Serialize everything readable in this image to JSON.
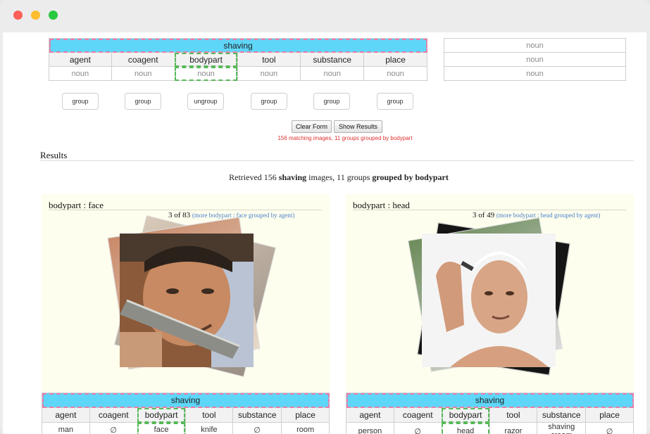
{
  "window": {
    "controls": [
      "close",
      "minimize",
      "zoom"
    ]
  },
  "query": {
    "verb": "shaving",
    "roles": [
      "agent",
      "coagent",
      "bodypart",
      "tool",
      "substance",
      "place"
    ],
    "values": [
      "noun",
      "noun",
      "noun",
      "noun",
      "noun",
      "noun"
    ],
    "selected_role": "bodypart",
    "side_values": [
      "noun",
      "noun",
      "noun"
    ],
    "group_buttons": [
      "group",
      "group",
      "ungroup",
      "group",
      "group",
      "group"
    ]
  },
  "actions": {
    "clear_label": "Clear Form",
    "show_label": "Show Results"
  },
  "status_text": "156 matching images, 11 groups grouped by bodypart",
  "results": {
    "heading": "Results",
    "summary": {
      "pre": "Retrieved 156 ",
      "verb": "shaving",
      "mid": " images, 11 groups ",
      "grouped": "grouped by bodypart"
    }
  },
  "groups": [
    {
      "title": "bodypart : face",
      "count": "3 of 83",
      "more": "(more bodypart : face grouped by agent)",
      "verb": "shaving",
      "roles": [
        "agent",
        "coagent",
        "bodypart",
        "tool",
        "substance",
        "place"
      ],
      "values": [
        "man",
        "∅",
        "face",
        "knife",
        "∅",
        "room"
      ]
    },
    {
      "title": "bodypart : head",
      "count": "3 of 49",
      "more": "(more bodypart : head grouped by agent)",
      "verb": "shaving",
      "roles": [
        "agent",
        "coagent",
        "bodypart",
        "tool",
        "substance",
        "place"
      ],
      "values": [
        "person",
        "∅",
        "head",
        "razor",
        "shaving cream",
        "∅"
      ]
    }
  ],
  "colors": {
    "verb_bg": "#5ed6f7",
    "selected_outline": "#58b95a",
    "verb_outline": "#e87dab",
    "status": "#e0302f",
    "link": "#4a7fc8",
    "card_bg": "#fefeee"
  }
}
